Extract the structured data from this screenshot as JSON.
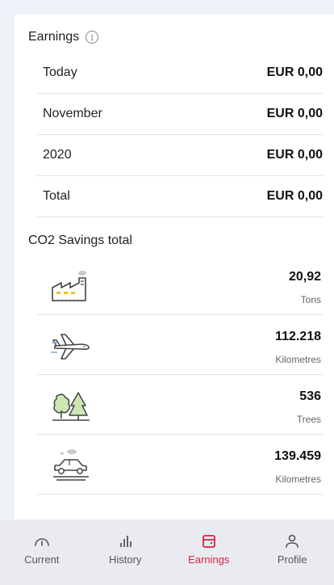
{
  "earnings": {
    "title": "Earnings",
    "info_glyph": "i",
    "rows": [
      {
        "label": "Today",
        "value": "EUR 0,00"
      },
      {
        "label": "November",
        "value": "EUR 0,00"
      },
      {
        "label": "2020",
        "value": "EUR 0,00"
      },
      {
        "label": "Total",
        "value": "EUR 0,00"
      }
    ]
  },
  "co2": {
    "title": "CO2 Savings total",
    "rows": [
      {
        "icon": "factory-icon",
        "value": "20,92",
        "unit": "Tons"
      },
      {
        "icon": "airplane-icon",
        "value": "112.218",
        "unit": "Kilometres"
      },
      {
        "icon": "trees-icon",
        "value": "536",
        "unit": "Trees"
      },
      {
        "icon": "car-icon",
        "value": "139.459",
        "unit": "Kilometres"
      }
    ]
  },
  "nav": {
    "active": "Earnings",
    "accent_color": "#e0213f",
    "items": [
      {
        "label": "Current",
        "icon": "gauge-icon"
      },
      {
        "label": "History",
        "icon": "bar-chart-icon"
      },
      {
        "label": "Earnings",
        "icon": "wallet-icon"
      },
      {
        "label": "Profile",
        "icon": "user-icon"
      }
    ]
  }
}
